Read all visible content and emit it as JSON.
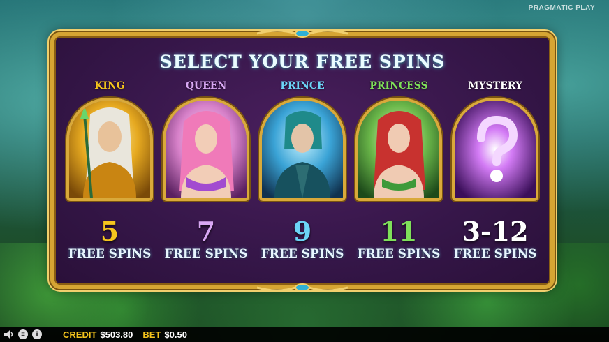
{
  "brand": "PRAGMATIC PLAY",
  "title": "SELECT YOUR FREE SPINS",
  "colors": {
    "panel_bg": "#351648",
    "frame_gold": "#d6a533",
    "king": "#f5c51d",
    "queen": "#d8a7f3",
    "prince": "#6cd4f7",
    "princess": "#7fe05a",
    "mystery": "#ffffff"
  },
  "options": [
    {
      "name": "KING",
      "count": "5",
      "spins_label": "FREE SPINS",
      "icon": "king-portrait"
    },
    {
      "name": "QUEEN",
      "count": "7",
      "spins_label": "FREE SPINS",
      "icon": "queen-portrait"
    },
    {
      "name": "PRINCE",
      "count": "9",
      "spins_label": "FREE SPINS",
      "icon": "prince-portrait"
    },
    {
      "name": "PRINCESS",
      "count": "11",
      "spins_label": "FREE SPINS",
      "icon": "princess-portrait"
    },
    {
      "name": "MYSTERY",
      "count": "3-12",
      "spins_label": "FREE SPINS",
      "icon": "question-mark-icon"
    }
  ],
  "status_bar": {
    "credit_label": "CREDIT",
    "credit_value": "$503.80",
    "bet_label": "BET",
    "bet_value": "$0.50",
    "icons": [
      "speaker-icon",
      "menu-icon",
      "info-icon"
    ]
  }
}
